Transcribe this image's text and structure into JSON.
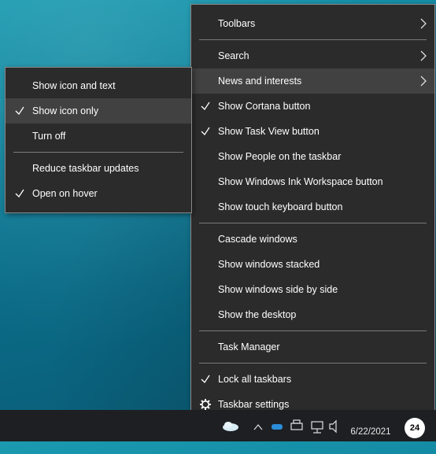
{
  "main_menu": {
    "toolbars": "Toolbars",
    "search": "Search",
    "news": "News and interests",
    "cortana": "Show Cortana button",
    "task_view": "Show Task View button",
    "people": "Show People on the taskbar",
    "ink": "Show Windows Ink Workspace button",
    "touch_keyboard": "Show touch keyboard button",
    "cascade": "Cascade windows",
    "stacked": "Show windows stacked",
    "side_by_side": "Show windows side by side",
    "desktop": "Show the desktop",
    "task_manager": "Task Manager",
    "lock": "Lock all taskbars",
    "settings": "Taskbar settings"
  },
  "sub_menu": {
    "icon_and_text": "Show icon and text",
    "icon_only": "Show icon only",
    "turn_off": "Turn off",
    "reduce_updates": "Reduce taskbar updates",
    "open_on_hover": "Open on hover"
  },
  "checks": {
    "cortana": true,
    "task_view": true,
    "lock": true,
    "icon_only": true,
    "open_on_hover": true
  },
  "taskbar": {
    "date": "6/22/2021",
    "notification_count": "24"
  },
  "colors": {
    "menu_bg": "#2b2b2b",
    "hover_bg": "#414141",
    "taskbar_bg": "#1d1f22"
  }
}
